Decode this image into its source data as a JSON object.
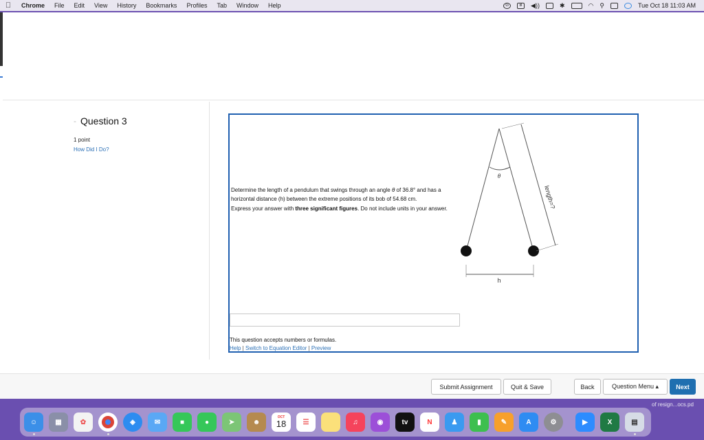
{
  "menubar": {
    "app": "Chrome",
    "items": [
      "File",
      "Edit",
      "View",
      "History",
      "Bookmarks",
      "Profiles",
      "Tab",
      "Window",
      "Help"
    ],
    "clock": "Tue Oct 18  11:03 AM"
  },
  "question": {
    "title": "Question 3",
    "points": "1 point",
    "how_did_i_do": "How Did I Do?",
    "text_1a": "Determine the length of a pendulum that swings through an angle ",
    "theta": "θ",
    "text_1b": " of 36.8° and has a horizontal distance (h) between the extreme positions of its bob of 54.68 cm.",
    "text_2a": "Express your answer with ",
    "text_2b": "three significant figures",
    "text_2c": ". Do not include units in your answer.",
    "answer_value": "",
    "accepts": "This question accepts numbers or formulas.",
    "help_link": "Help",
    "equation_link": "Switch to Equation Editor",
    "preview_link": "Preview",
    "sep": " | "
  },
  "diagram": {
    "theta_label": "θ",
    "length_label": "length=?",
    "h_label": "h"
  },
  "toolbar": {
    "submit": "Submit Assignment",
    "quit": "Quit & Save",
    "back": "Back",
    "question_menu": "Question Menu ▴",
    "next": "Next"
  },
  "dock": {
    "calendar_month": "OCT",
    "calendar_day": "18",
    "tv_label": "tv",
    "file_label": "of resign...ocs.pd"
  }
}
